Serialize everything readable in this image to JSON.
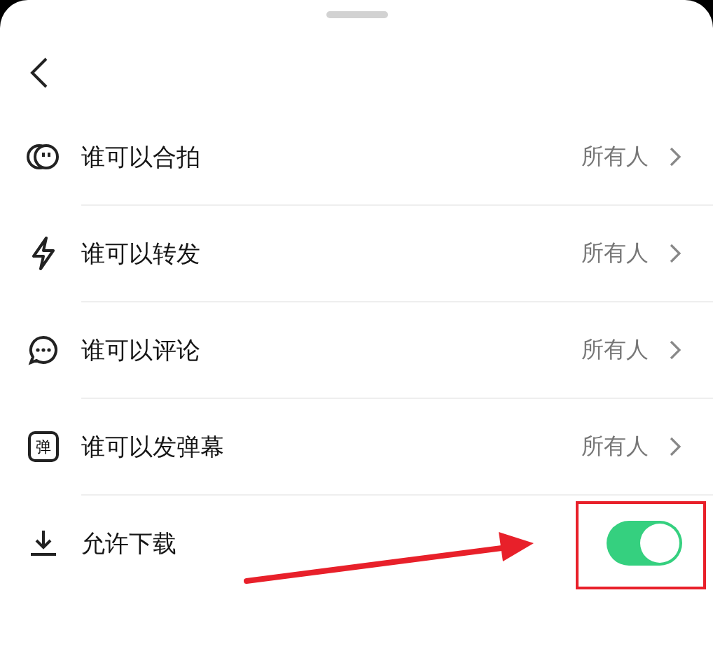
{
  "settings": [
    {
      "kind": "link",
      "label": "谁可以合拍",
      "value": "所有人"
    },
    {
      "kind": "link",
      "label": "谁可以转发",
      "value": "所有人"
    },
    {
      "kind": "link",
      "label": "谁可以评论",
      "value": "所有人"
    },
    {
      "kind": "link",
      "label": "谁可以发弹幕",
      "value": "所有人",
      "icon_text": "弹"
    },
    {
      "kind": "toggle",
      "label": "允许下载",
      "on": true
    }
  ]
}
